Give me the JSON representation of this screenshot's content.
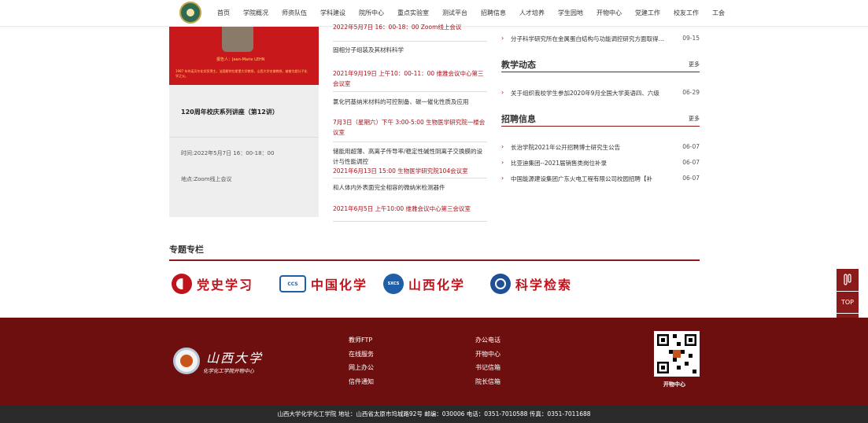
{
  "nav": {
    "items": [
      "首页",
      "学院概况",
      "师资队伍",
      "学科建设",
      "院所中心",
      "重点实验室",
      "测试平台",
      "招聘信息",
      "人才培养",
      "学生园地",
      "开物中心",
      "党建工作",
      "校友工作",
      "工会"
    ]
  },
  "feature": {
    "image_reporter": "报告人：Jean-Marie LEHN",
    "image_desc": "1987 年的诺贝尔化学奖得主，法国斯特拉斯堡大学教授，山西大学名誉教授，被誉为超分子化学之父。",
    "title": "120周年校庆系列讲座（第12讲）",
    "time": "时间:2022年5月7日 16：00-18：00",
    "place": "地点:Zoom线上会议"
  },
  "lectures": [
    {
      "date": "2022年5月7日 16：00-18：00 Zoom线上会议",
      "title": "固相分子组装及其材料科学"
    },
    {
      "date": "2021年9月19日 上午10：00-11：00 维雅会议中心第三会议室",
      "title": "氯化钙基纳米材料的可控制备、碳一催化性质及应用"
    },
    {
      "date": "7月3日（星期六）下午 3:00-5:00 生物医学研究院一楼会议室",
      "title": "储能用超薄、高离子传导率/稳定性碱性阴离子交换膜的设计与性能调控"
    },
    {
      "date": "2021年6月13日 15:00 生物医学研究院104会议室",
      "title": "和人体内外表面完全相容的微纳米检测器件"
    },
    {
      "date": "2021年6月5日 上午10:00 维雅会议中心第三会议室",
      "title": ""
    }
  ],
  "right": {
    "top_news": {
      "text": "分子科学研究所在金属蛋白结构与功能调控研究方面取得...",
      "date": "09-15"
    },
    "teaching": {
      "title": "教学动态",
      "more": "更多",
      "items": [
        {
          "text": "关于组织我校学生参加2020年9月全国大学英语四、六级",
          "date": "06-29"
        }
      ]
    },
    "recruit": {
      "title": "招聘信息",
      "more": "更多",
      "items": [
        {
          "text": "长治学院2021年公开招聘博士研究生公告",
          "date": "06-07"
        },
        {
          "text": "比亚迪集团--2021届销售类岗位补录",
          "date": "06-07"
        },
        {
          "text": "中国能源建设集团广东火电工程有限公司校园招聘【补",
          "date": "06-07"
        }
      ]
    }
  },
  "special": {
    "title": "专题专栏",
    "banners": [
      {
        "text": "党史学习",
        "color": "#c0141c"
      },
      {
        "text": "中国化学",
        "color": "#c0141c",
        "badge": "CCS"
      },
      {
        "text": "山西化学",
        "color": "#c0141c",
        "badge": "SXCS"
      },
      {
        "text": "科学检索",
        "color": "#c0141c"
      }
    ]
  },
  "side_float": {
    "top_label": "TOP"
  },
  "footer": {
    "school_name": "山西大学",
    "school_sub": "化学化工学院开物中心",
    "links_col1": [
      "教师FTP",
      "在线服务",
      "网上办公",
      "信件通知"
    ],
    "links_col2": [
      "办公电话",
      "开物中心",
      "书记信箱",
      "院长信箱"
    ],
    "qr_label": "开物中心",
    "bottom": "山西大学化学化工学院   地址：山西省太原市坞城路92号   邮编：030006   电话：0351-7010588   传真：0351-7011688"
  },
  "colors": {
    "accent": "#8b1a1a",
    "date_red": "#a0141c",
    "footer_bg": "#6e0f0f"
  }
}
